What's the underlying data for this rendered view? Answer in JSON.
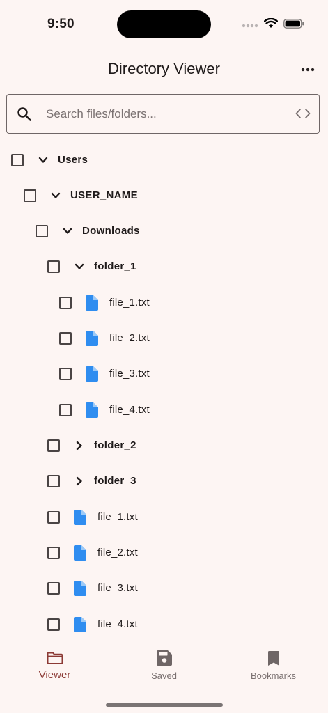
{
  "status_bar": {
    "time": "9:50"
  },
  "app_bar": {
    "title": "Directory Viewer",
    "more_icon": "more-horizontal-icon"
  },
  "search": {
    "placeholder": "Search files/folders...",
    "value": ""
  },
  "tree": [
    {
      "label": "Users",
      "type": "folder",
      "depth": 0,
      "expanded": true,
      "checked": false
    },
    {
      "label": "USER_NAME",
      "type": "folder",
      "depth": 1,
      "expanded": true,
      "checked": false
    },
    {
      "label": "Downloads",
      "type": "folder",
      "depth": 2,
      "expanded": true,
      "checked": false
    },
    {
      "label": "folder_1",
      "type": "folder",
      "depth": 3,
      "expanded": true,
      "checked": false
    },
    {
      "label": "file_1.txt",
      "type": "file",
      "depth": 4,
      "checked": false
    },
    {
      "label": "file_2.txt",
      "type": "file",
      "depth": 4,
      "checked": false
    },
    {
      "label": "file_3.txt",
      "type": "file",
      "depth": 4,
      "checked": false
    },
    {
      "label": "file_4.txt",
      "type": "file",
      "depth": 4,
      "checked": false
    },
    {
      "label": "folder_2",
      "type": "folder",
      "depth": 3,
      "expanded": false,
      "checked": false
    },
    {
      "label": "folder_3",
      "type": "folder",
      "depth": 3,
      "expanded": false,
      "checked": false
    },
    {
      "label": "file_1.txt",
      "type": "file",
      "depth": 3,
      "checked": false
    },
    {
      "label": "file_2.txt",
      "type": "file",
      "depth": 3,
      "checked": false
    },
    {
      "label": "file_3.txt",
      "type": "file",
      "depth": 3,
      "checked": false
    },
    {
      "label": "file_4.txt",
      "type": "file",
      "depth": 3,
      "checked": false
    }
  ],
  "bottom_nav": {
    "items": [
      {
        "label": "Viewer",
        "icon": "folder-icon",
        "active": true
      },
      {
        "label": "Saved",
        "icon": "save-icon",
        "active": false
      },
      {
        "label": "Bookmarks",
        "icon": "bookmark-icon",
        "active": false
      }
    ]
  },
  "colors": {
    "background": "#fdf5f3",
    "accent": "#8c3a35",
    "file_icon": "#2f8df0",
    "inactive": "#7a7070"
  }
}
